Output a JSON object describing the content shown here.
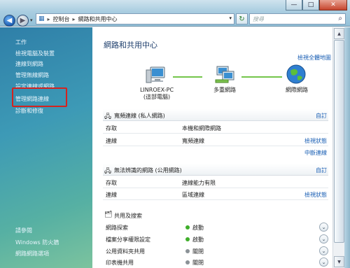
{
  "window": {
    "minimize": "—",
    "maximize": "□",
    "close": "✕"
  },
  "nav": {
    "back_glyph": "◀",
    "forward_glyph": "▶",
    "address": [
      "控制台",
      "網路和共用中心"
    ],
    "search_placeholder": "搜尋"
  },
  "sidebar": {
    "tasks_heading": "工作",
    "links": [
      "檢視電腦及裝置",
      "連線到網路",
      "管理無線網路",
      "設定連線或網路",
      "管理網路連線",
      "診斷和修復"
    ],
    "see_also_heading": "請參閱",
    "see_also": [
      "Windows 防火牆",
      "網路網路選項"
    ]
  },
  "main": {
    "title": "網路和共用中心",
    "view_full_map": "檢視全體地圖",
    "map": {
      "computer_name": "LINROEX-PC",
      "computer_sub": "(這部電腦)",
      "network": "多重網路",
      "internet": "網際網路"
    },
    "section1": {
      "title": "寬頻連線 (私人網路)",
      "action": "自訂",
      "rows": [
        {
          "k": "存取",
          "v": "本機和網際網路",
          "a": ""
        },
        {
          "k": "連線",
          "v": "寬頻連線",
          "a": "檢視狀態"
        },
        {
          "k": "",
          "v": "",
          "a": "中斷連線"
        }
      ]
    },
    "section2": {
      "title": "無法辨識的網路 (公用網路)",
      "action": "自訂",
      "rows": [
        {
          "k": "存取",
          "v": "連線能力有限",
          "a": ""
        },
        {
          "k": "連線",
          "v": "區域連線",
          "a": "檢視狀態"
        }
      ]
    },
    "sharing": {
      "title": "共用及搜索",
      "rows": [
        {
          "k": "網路探索",
          "v": "啟動",
          "status": "on"
        },
        {
          "k": "檔案分享權限設定",
          "v": "啟動",
          "status": "on"
        },
        {
          "k": "公用資料夾共用",
          "v": "關閉",
          "status": "off"
        },
        {
          "k": "印表機共用",
          "v": "關閉",
          "status": "off"
        }
      ]
    }
  },
  "colors": {
    "on": "#3fae2a",
    "off": "#8b9297",
    "highlight": "#d4231f"
  }
}
